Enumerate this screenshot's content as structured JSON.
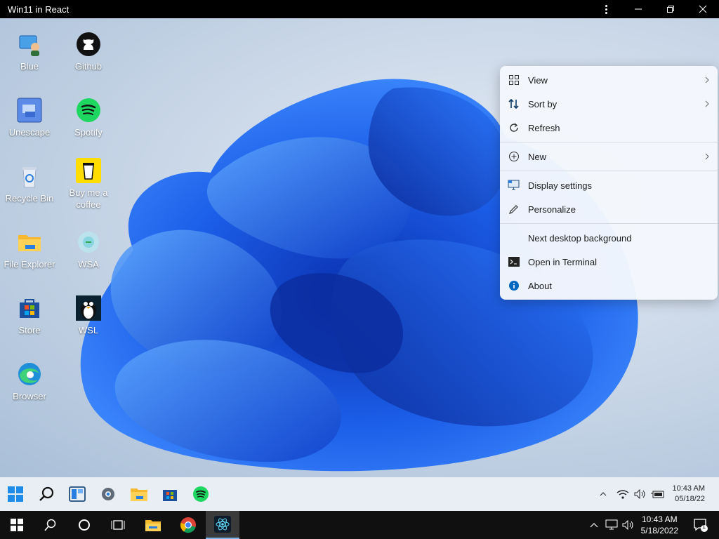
{
  "window": {
    "title": "Win11 in React"
  },
  "desktop_icons": [
    {
      "label": "Blue",
      "icon": "blue-user-icon"
    },
    {
      "label": "Github",
      "icon": "github-icon"
    },
    {
      "label": "Unescape",
      "icon": "unescape-icon"
    },
    {
      "label": "Spotify",
      "icon": "spotify-icon"
    },
    {
      "label": "Recycle Bin",
      "icon": "recycle-bin-icon"
    },
    {
      "label": "Buy me a coffee",
      "icon": "coffee-cup-icon"
    },
    {
      "label": "File Explorer",
      "icon": "folder-icon"
    },
    {
      "label": "WSA",
      "icon": "wsa-icon"
    },
    {
      "label": "Store",
      "icon": "store-icon"
    },
    {
      "label": "WSL",
      "icon": "linux-penguin-icon"
    },
    {
      "label": "Browser",
      "icon": "edge-icon"
    }
  ],
  "context_menu": {
    "items": [
      {
        "label": "View",
        "icon": "grid-icon",
        "submenu": true
      },
      {
        "label": "Sort by",
        "icon": "sort-icon",
        "submenu": true
      },
      {
        "label": "Refresh",
        "icon": "refresh-icon",
        "submenu": false
      },
      {
        "label": "New",
        "icon": "plus-circle-icon",
        "submenu": true
      },
      {
        "label": "Display settings",
        "icon": "monitor-icon",
        "submenu": false
      },
      {
        "label": "Personalize",
        "icon": "pen-icon",
        "submenu": false
      },
      {
        "label": "Next desktop background",
        "icon": "",
        "submenu": false
      },
      {
        "label": "Open in Terminal",
        "icon": "terminal-icon",
        "submenu": false
      },
      {
        "label": "About",
        "icon": "info-icon",
        "submenu": false
      }
    ]
  },
  "win11_taskbar": {
    "apps": [
      "start-icon",
      "search-icon",
      "widgets-icon",
      "settings-icon",
      "file-explorer-icon",
      "store-icon",
      "spotify-icon"
    ],
    "clock": {
      "time": "10:43 AM",
      "date": "05/18/22"
    }
  },
  "host_taskbar": {
    "clock": {
      "time": "10:43 AM",
      "date": "5/18/2022"
    },
    "notification_count": "1"
  },
  "colors": {
    "accent": "#0067c0",
    "spotify": "#1ed760",
    "coffee": "#ffdd00"
  }
}
